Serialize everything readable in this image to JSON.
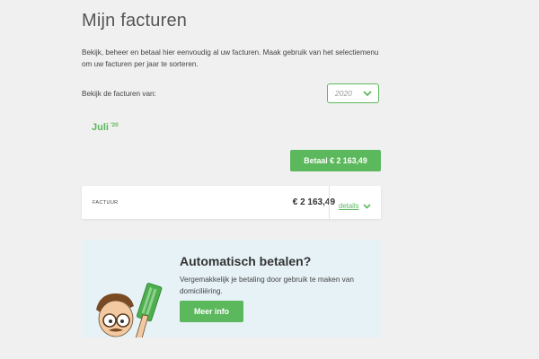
{
  "page": {
    "title": "Mijn facturen",
    "intro": "Bekijk, beheer en betaal hier eenvoudig al uw facturen. Maak gebruik van het selectiemenu om uw facturen per jaar te sorteren."
  },
  "filter": {
    "label": "Bekijk de facturen van:",
    "selected_year": "2020",
    "icon": "chevron-down-icon"
  },
  "period": {
    "month": "Juli",
    "year_suffix": "'20"
  },
  "pay": {
    "label": "Betaal € 2 163,49"
  },
  "invoice": {
    "type": "FACTUUR",
    "amount": "€ 2 163,49",
    "details_label": "details",
    "details_icon": "chevron-down-icon"
  },
  "promo": {
    "title": "Automatisch betalen?",
    "text": "Vergemakkelijk je betaling door gebruik te maken van domiciliëring.",
    "button_label": "Meer info",
    "illustration": "mascot-with-card-illustration"
  },
  "colors": {
    "accent": "#5cb85c",
    "background": "#f0f0f0",
    "promo_background": "#e6f2f6"
  }
}
